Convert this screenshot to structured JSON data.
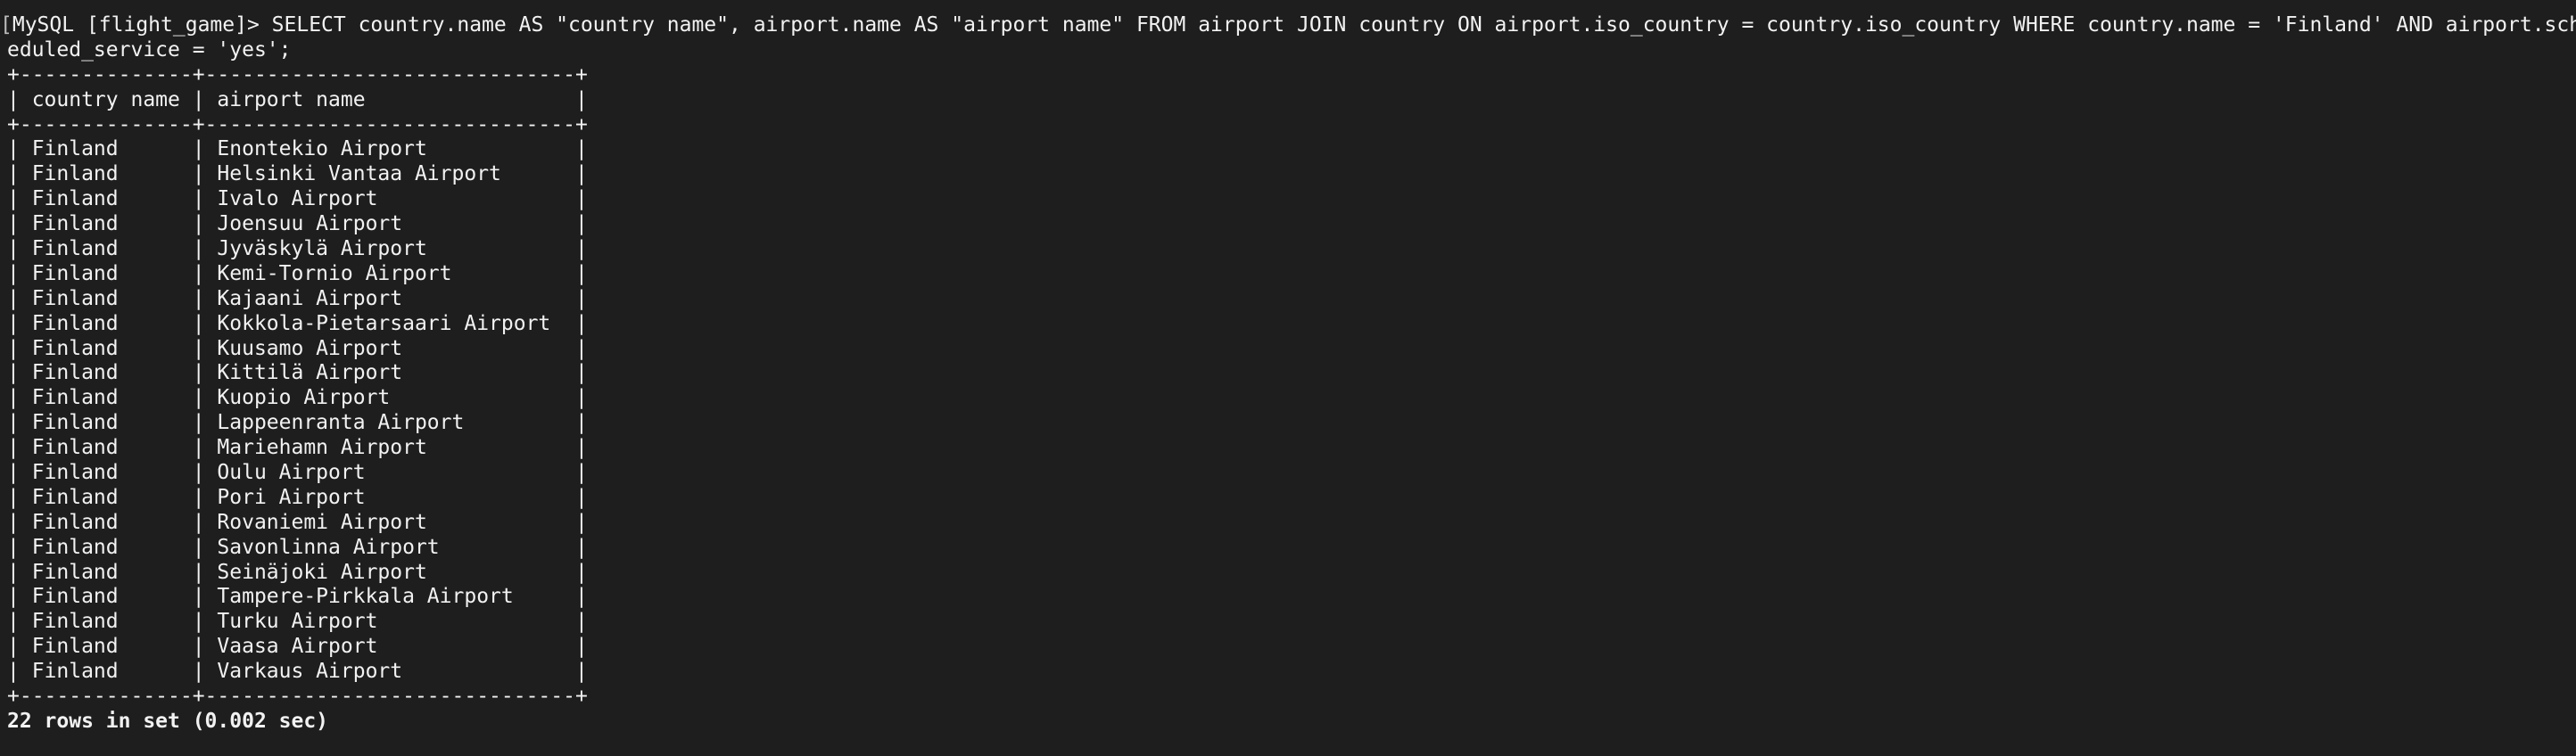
{
  "terminal": {
    "prompt": "MySQL [flight_game]> ",
    "cursor_mark": "[",
    "command_line1": "SELECT country.name AS \"country name\", airport.name AS \"airport name\" FROM airport JOIN country ON airport.iso_country = country.iso_country WHERE country.name = 'Finland' AND airport.sch",
    "command_line2": "eduled_service = 'yes';",
    "table": {
      "border": "+--------------+------------------------------+",
      "header": "| country name | airport name                 |",
      "rows": [
        "| Finland      | Enontekio Airport            |",
        "| Finland      | Helsinki Vantaa Airport      |",
        "| Finland      | Ivalo Airport                |",
        "| Finland      | Joensuu Airport              |",
        "| Finland      | Jyväskylä Airport            |",
        "| Finland      | Kemi-Tornio Airport          |",
        "| Finland      | Kajaani Airport              |",
        "| Finland      | Kokkola-Pietarsaari Airport  |",
        "| Finland      | Kuusamo Airport              |",
        "| Finland      | Kittilä Airport              |",
        "| Finland      | Kuopio Airport               |",
        "| Finland      | Lappeenranta Airport         |",
        "| Finland      | Mariehamn Airport            |",
        "| Finland      | Oulu Airport                 |",
        "| Finland      | Pori Airport                 |",
        "| Finland      | Rovaniemi Airport            |",
        "| Finland      | Savonlinna Airport           |",
        "| Finland      | Seinäjoki Airport            |",
        "| Finland      | Tampere-Pirkkala Airport     |",
        "| Finland      | Turku Airport                |",
        "| Finland      | Vaasa Airport                |",
        "| Finland      | Varkaus Airport              |"
      ]
    },
    "summary": "22 rows in set (0.002 sec)",
    "colors": {
      "background": "#1e1e1e",
      "text": "#f2f2f2"
    }
  }
}
